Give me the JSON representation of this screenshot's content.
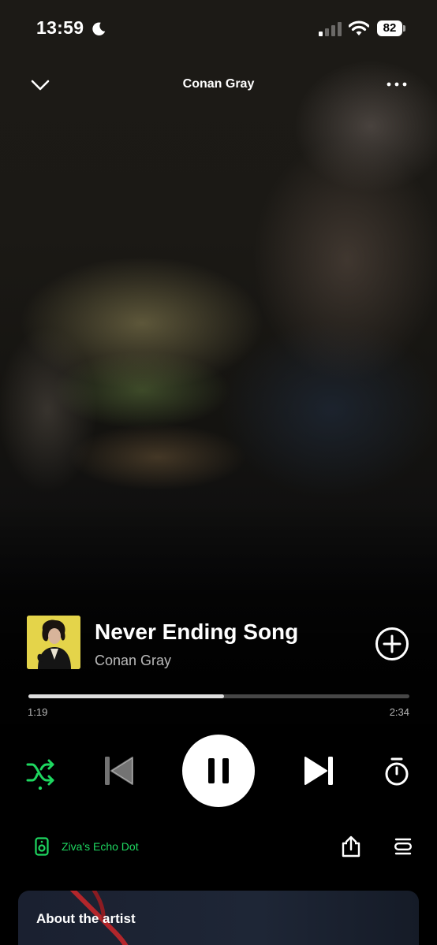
{
  "status_bar": {
    "time": "13:59",
    "battery": "82"
  },
  "header": {
    "title": "Conan Gray"
  },
  "track": {
    "title": "Never Ending Song",
    "artist": "Conan Gray",
    "album_art_bg": "#e4d44a"
  },
  "progress": {
    "elapsed": "1:19",
    "total": "2:34",
    "fraction": 0.513
  },
  "controls": {
    "shuffle_active": true,
    "state": "playing"
  },
  "device": {
    "label": "Ziva's Echo Dot"
  },
  "about": {
    "title": "About the artist"
  },
  "colors": {
    "accent": "#1ed760",
    "text_primary": "#ffffff",
    "text_secondary": "rgba(255,255,255,0.72)"
  },
  "icons": [
    "moon-icon",
    "signal-icon",
    "wifi-icon",
    "chevron-down-icon",
    "more-icon",
    "add-circle-icon",
    "shuffle-icon",
    "previous-icon",
    "pause-icon",
    "next-icon",
    "sleep-timer-icon",
    "speaker-icon",
    "share-icon",
    "queue-icon"
  ]
}
